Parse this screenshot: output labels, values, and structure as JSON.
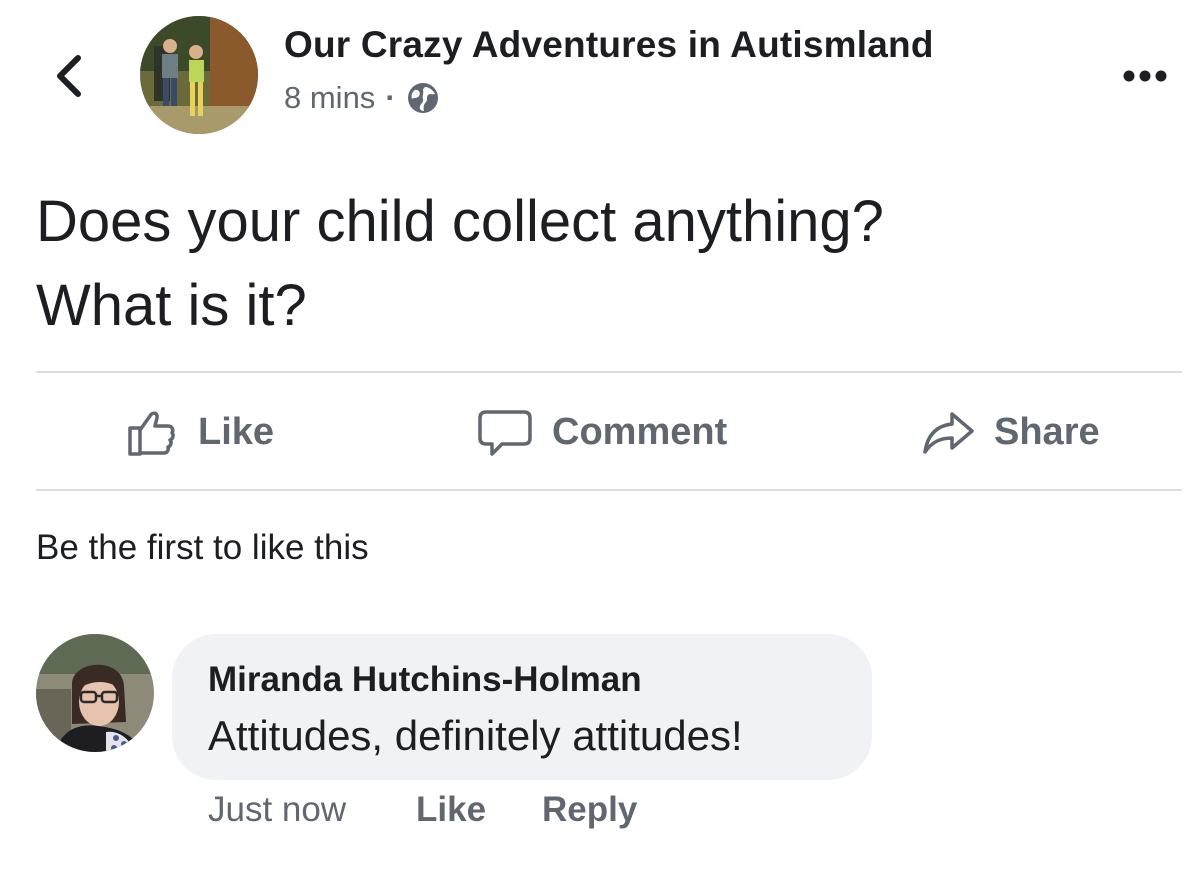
{
  "header": {
    "page_name": "Our Crazy Adventures in Autismland",
    "timestamp": "8 mins",
    "separator": "·",
    "privacy_icon": "globe-icon",
    "back_icon": "chevron-left-icon",
    "more_icon": "more-horizontal-icon"
  },
  "post": {
    "text_line1": "Does your child collect anything?",
    "text_line2": "What is it?"
  },
  "actions": {
    "like_label": "Like",
    "comment_label": "Comment",
    "share_label": "Share"
  },
  "reactions": {
    "summary": "Be the first to like this"
  },
  "comments": [
    {
      "author": "Miranda Hutchins-Holman",
      "text": "Attitudes, definitely attitudes!",
      "time": "Just now",
      "like_label": "Like",
      "reply_label": "Reply"
    }
  ],
  "colors": {
    "primary_text": "#1c1e21",
    "secondary_text": "#606770",
    "divider": "#dadde1",
    "comment_bubble": "#f0f2f5"
  }
}
